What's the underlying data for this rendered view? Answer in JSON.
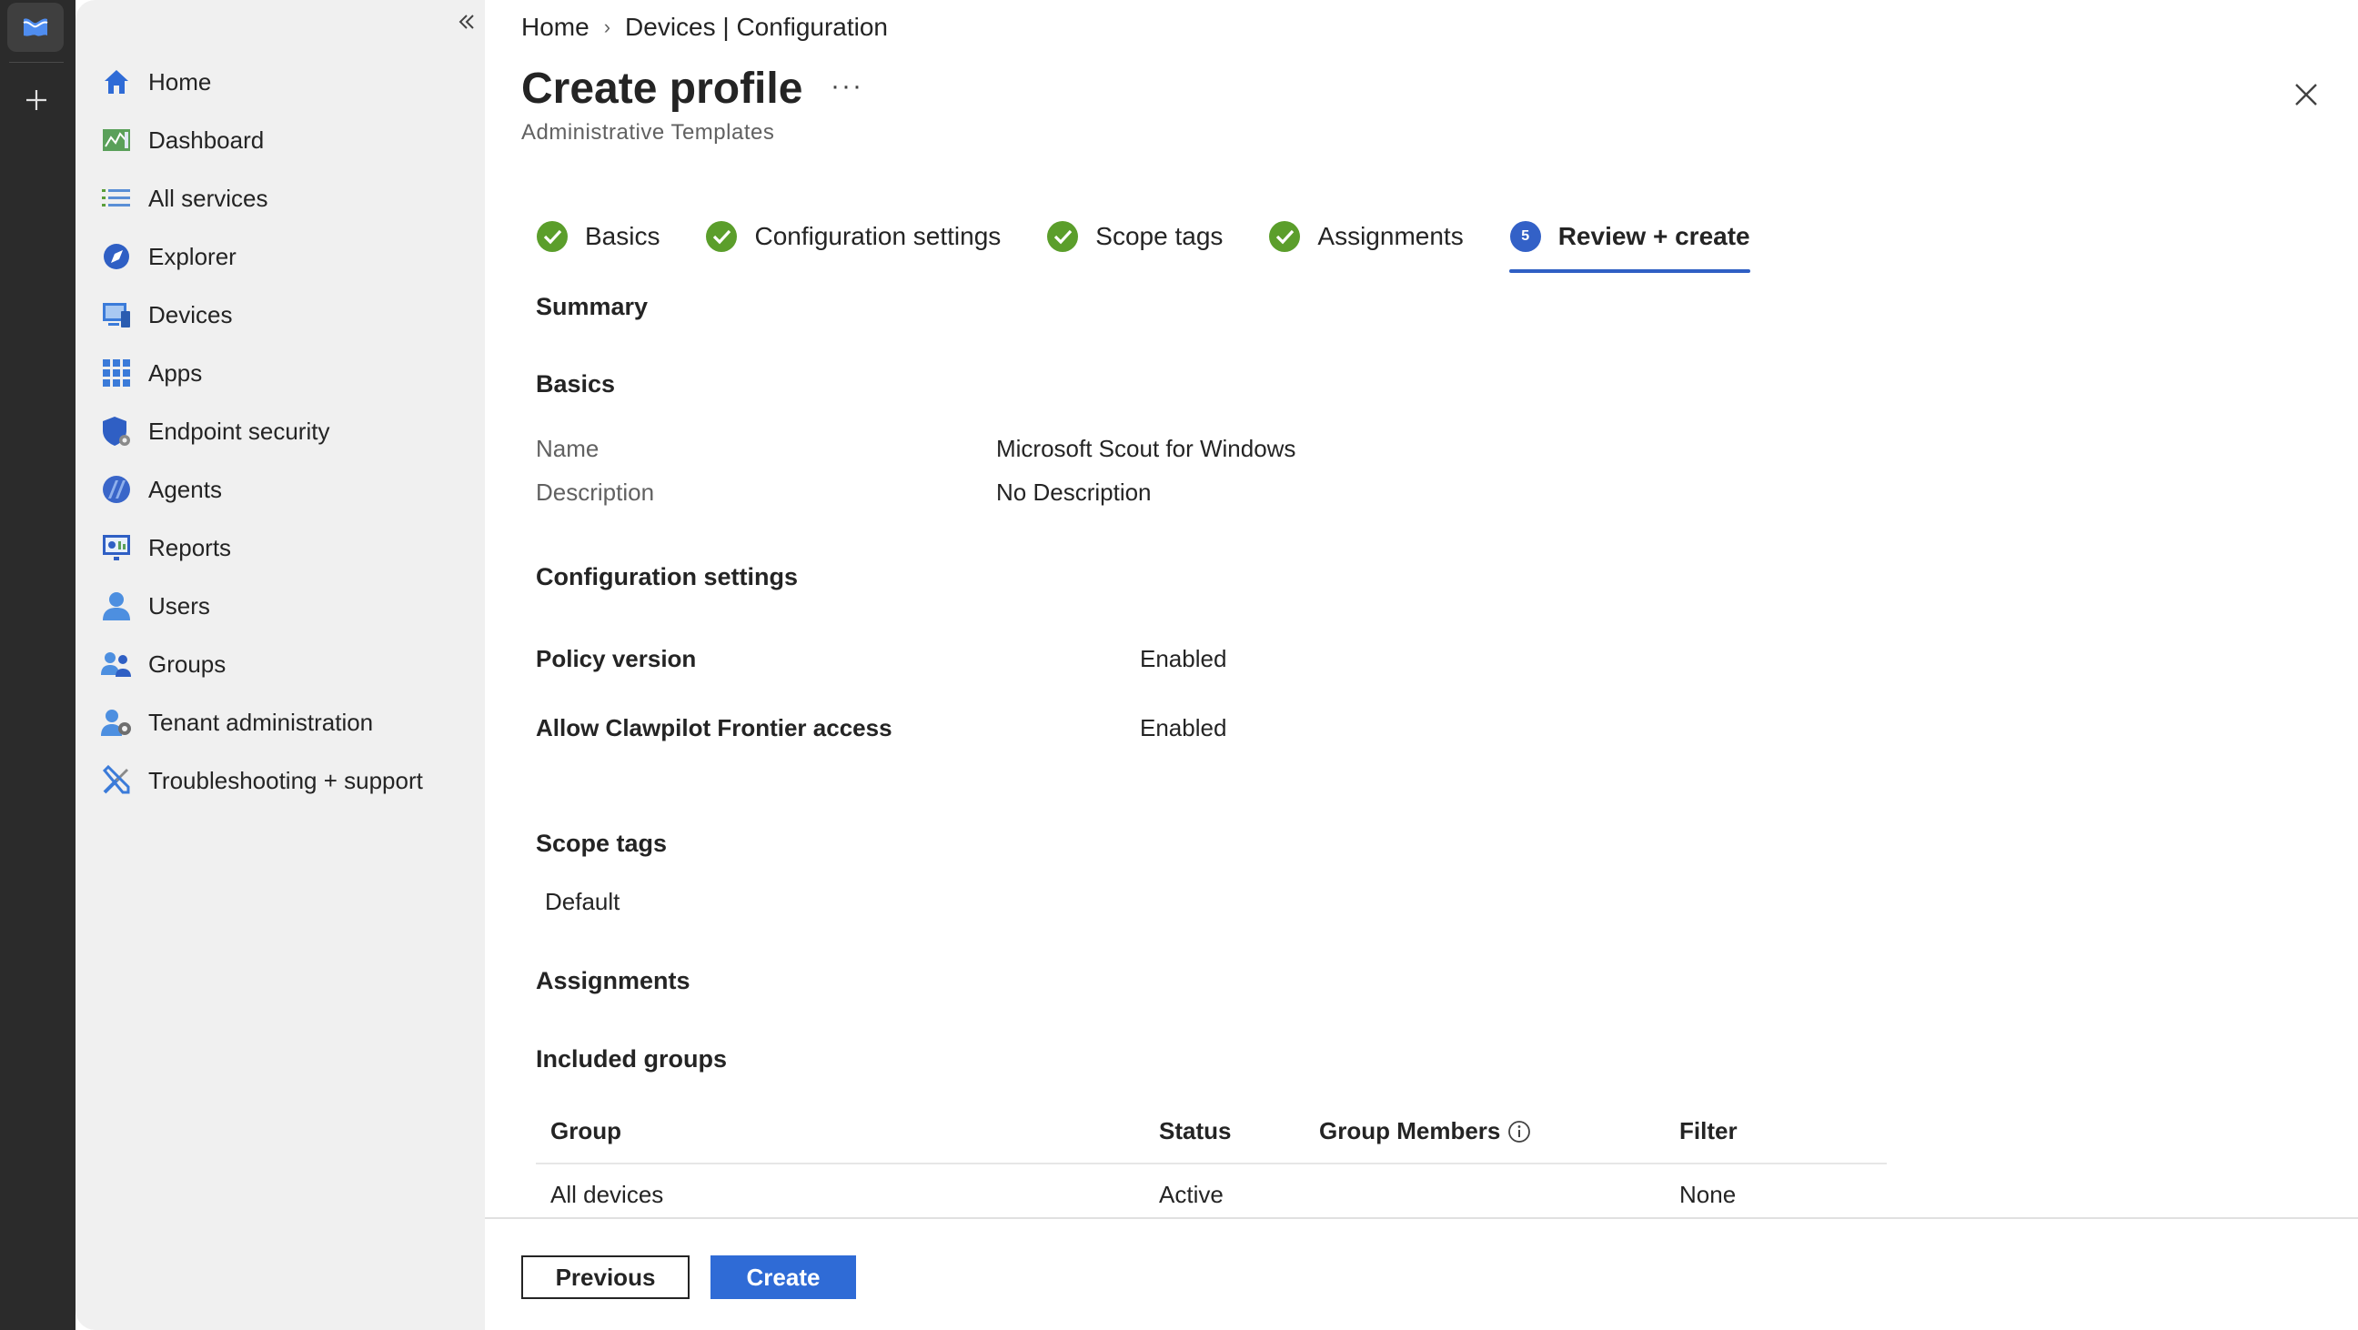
{
  "nav": {
    "items": [
      {
        "label": "Home",
        "icon": "home-icon"
      },
      {
        "label": "Dashboard",
        "icon": "dashboard-icon"
      },
      {
        "label": "All services",
        "icon": "list-icon"
      },
      {
        "label": "Explorer",
        "icon": "explorer-icon"
      },
      {
        "label": "Devices",
        "icon": "devices-icon"
      },
      {
        "label": "Apps",
        "icon": "apps-icon"
      },
      {
        "label": "Endpoint security",
        "icon": "shield-icon"
      },
      {
        "label": "Agents",
        "icon": "agents-icon"
      },
      {
        "label": "Reports",
        "icon": "reports-icon"
      },
      {
        "label": "Users",
        "icon": "user-icon"
      },
      {
        "label": "Groups",
        "icon": "groups-icon"
      },
      {
        "label": "Tenant administration",
        "icon": "tenant-admin-icon"
      },
      {
        "label": "Troubleshooting + support",
        "icon": "tools-icon"
      }
    ]
  },
  "breadcrumb": {
    "home": "Home",
    "current": "Devices | Configuration"
  },
  "header": {
    "title": "Create profile",
    "more": "···",
    "subtitle": "Administrative Templates"
  },
  "steps": [
    {
      "label": "Basics",
      "state": "done"
    },
    {
      "label": "Configuration settings",
      "state": "done"
    },
    {
      "label": "Scope tags",
      "state": "done"
    },
    {
      "label": "Assignments",
      "state": "done"
    },
    {
      "label": "Review + create",
      "state": "active",
      "number": "5"
    }
  ],
  "summary": {
    "heading": "Summary",
    "basics": {
      "heading": "Basics",
      "name_label": "Name",
      "name_value": "Microsoft Scout for Windows",
      "desc_label": "Description",
      "desc_value": "No Description"
    },
    "config": {
      "heading": "Configuration settings",
      "rows": [
        {
          "key": "Policy version",
          "value": "Enabled"
        },
        {
          "key": "Allow Clawpilot Frontier access",
          "value": "Enabled"
        }
      ]
    },
    "scope": {
      "heading": "Scope tags",
      "value": "Default"
    },
    "assignments": {
      "heading": "Assignments",
      "included_heading": "Included groups",
      "columns": {
        "group": "Group",
        "status": "Status",
        "members": "Group Members",
        "filter": "Filter"
      },
      "rows": [
        {
          "group": "All devices",
          "status": "Active",
          "members": "",
          "filter": "None"
        }
      ]
    }
  },
  "footer": {
    "previous": "Previous",
    "create": "Create"
  },
  "colors": {
    "accent": "#2f6bd6",
    "success": "#5b9e2b",
    "rail": "#2b2b2b",
    "sidebar": "#f0f0f0"
  }
}
